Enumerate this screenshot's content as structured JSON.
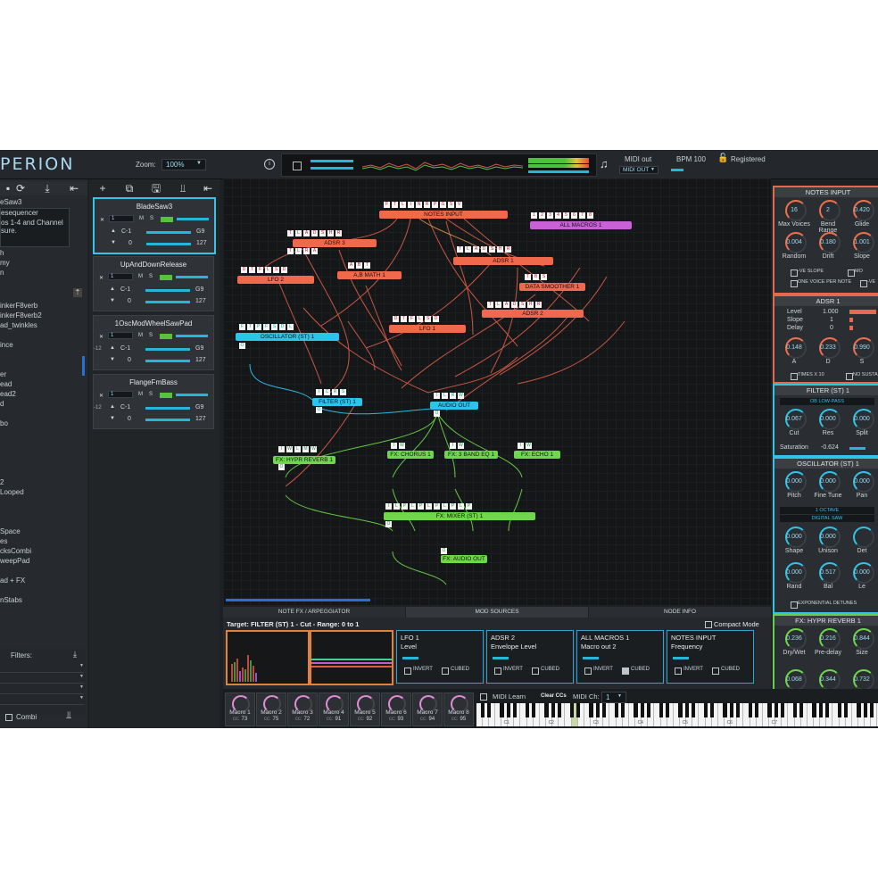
{
  "app": {
    "logo": "PERION"
  },
  "topbar": {
    "zoom_label": "Zoom:",
    "zoom_value": "100%",
    "midi_out_label": "MIDI out",
    "midi_out_value": "MIDI OUT",
    "bpm": "BPM 100",
    "registered": "Registered"
  },
  "left": {
    "preset_name": "eSaw3",
    "info_line1": "esequencer",
    "info_line2": "os 1-4 and Channel",
    "info_line3": "sure.",
    "info_line4": "h",
    "info_line5": "my",
    "info_line6": "n",
    "list": [
      "inkerF8verb",
      "inkerF8verb2",
      "ad_twinkles",
      "",
      "ince",
      "",
      "",
      "er",
      "ead",
      "ead2",
      "d",
      "",
      "bo",
      "",
      "",
      "",
      "",
      "",
      "2",
      "Looped",
      "",
      "",
      "",
      "Space",
      "es",
      "cksCombi",
      "weepPad",
      "",
      "ad + FX",
      "",
      "nStabs"
    ],
    "filters_label": "Filters:",
    "combi_label": "Combi"
  },
  "presets": [
    {
      "title": "BladeSaw3",
      "note_lo": "C-1",
      "note_hi": "G9",
      "vel_lo": "0",
      "vel_hi": "127",
      "transpose": "",
      "channel": "1"
    },
    {
      "title": "UpAndDownRelease",
      "note_lo": "C-1",
      "note_hi": "G9",
      "vel_lo": "0",
      "vel_hi": "127",
      "transpose": "",
      "channel": "1"
    },
    {
      "title": "1OscModWheelSawPad",
      "note_lo": "C-1",
      "note_hi": "G9",
      "vel_lo": "0",
      "vel_hi": "127",
      "transpose": "-12",
      "channel": "1"
    },
    {
      "title": "FlangeFmBass",
      "note_lo": "C-1",
      "note_hi": "G9",
      "vel_lo": "0",
      "vel_hi": "127",
      "transpose": "-12",
      "channel": "1"
    }
  ],
  "preset_row_labels": {
    "x": "X",
    "m": "M",
    "s": "S"
  },
  "nodes": {
    "notes_input": "NOTES INPUT",
    "all_macros": "ALL MACROS 1",
    "adsr3": "ADSR 3",
    "adsr1": "ADSR 1",
    "lfo2": "LFO 2",
    "ab_math": "A,B MATH 1",
    "data_smoother": "DATA SMOOTHER 1",
    "adsr2": "ADSR 2",
    "oscillator": "OSCILLATOR (ST) 1",
    "lfo1": "LFO 1",
    "filter": "FILTER (ST) 1",
    "audio_out": "AUDIO OUT",
    "hypr_reverb": "FX: HYPR REVERB 1",
    "chorus": "FX: CHORUS 1",
    "eq": "FX: 3 BAND EQ 1",
    "echo": "FX: ECHO 1",
    "mixer": "FX: MIXER (ST) 1",
    "fx_audio_out": "FX: AUDIO OUT"
  },
  "right": {
    "notes_input": {
      "title": "NOTES INPUT",
      "knobs": [
        {
          "label": "Max Voices",
          "value": "16"
        },
        {
          "label": "Bend Range",
          "value": "2"
        },
        {
          "label": "Glide",
          "value": "0.420"
        },
        {
          "label": "Random",
          "value": "0.004"
        },
        {
          "label": "Drift",
          "value": "0.180"
        },
        {
          "label": "Slope",
          "value": "1.001"
        }
      ],
      "opt1": "-VE SLOPE",
      "opt2": "MO",
      "opt3": "ONE VOICE PER NOTE",
      "opt4": "-VE"
    },
    "adsr": {
      "title": "ADSR 1",
      "level_label": "Level",
      "level_value": "1.000",
      "slope_label": "Slope",
      "slope_value": "1",
      "delay_label": "Delay",
      "delay_value": "0",
      "knobs": [
        {
          "label": "A",
          "value": "0.148"
        },
        {
          "label": "D",
          "value": "0.233"
        },
        {
          "label": "S",
          "value": "0.990"
        }
      ],
      "opt1": "TIMES X 10",
      "opt2": "NO SUSTA"
    },
    "filter": {
      "title": "FILTER (ST) 1",
      "mode": "OB LOW-PASS",
      "knobs": [
        {
          "label": "Cut",
          "value": "0.067"
        },
        {
          "label": "Res",
          "value": "0.000"
        },
        {
          "label": "Split",
          "value": "0.000"
        }
      ],
      "sat_label": "Saturation",
      "sat_value": "-0.624"
    },
    "oscillator": {
      "title": "OSCILLATOR (ST) 1",
      "knobs": [
        {
          "label": "Pitch",
          "value": "0.000"
        },
        {
          "label": "Fine Tune",
          "value": "0.000"
        },
        {
          "label": "Pan",
          "value": "0.000"
        }
      ],
      "octave": "1 OCTAVE",
      "wave": "DIGITAL SAW",
      "knobs2": [
        {
          "label": "Shape",
          "value": "0.000"
        },
        {
          "label": "Unison",
          "value": "0.000"
        },
        {
          "label": "Det",
          "value": ""
        }
      ],
      "knobs3": [
        {
          "label": "Rand",
          "value": "0.000"
        },
        {
          "label": "Bal",
          "value": "0.517"
        },
        {
          "label": "Le",
          "value": "0.000"
        }
      ],
      "opt": "EXPONENTIAL DETUNES"
    },
    "reverb": {
      "title": "FX: HYPR REVERB 1",
      "knobs": [
        {
          "label": "Dry/Wet",
          "value": "0.236"
        },
        {
          "label": "Pre-delay",
          "value": "0.216"
        },
        {
          "label": "Size",
          "value": "0.844"
        }
      ],
      "vals2": [
        "0.068",
        "0.344",
        "0.732"
      ]
    }
  },
  "bottom": {
    "tabs": [
      "NOTE FX / ARPEGGIATOR",
      "MOD SOURCES",
      "NODE INFO"
    ],
    "compact_mode": "Compact Mode",
    "target": "Target: FILTER (ST) 1 - Cut - Range: 0 to 1",
    "mods": [
      {
        "title": "LFO 1",
        "sub": "Level",
        "cubed_checked": false
      },
      {
        "title": "ADSR 2",
        "sub": "Envelope Level",
        "cubed_checked": false
      },
      {
        "title": "ALL MACROS 1",
        "sub": "Macro out 2",
        "cubed_checked": true
      },
      {
        "title": "NOTES INPUT",
        "sub": "Frequency",
        "cubed_checked": false
      }
    ],
    "invert_label": "INVERT",
    "cubed_label": "CUBED",
    "macros": [
      {
        "label": "Macro 1",
        "cc": "73"
      },
      {
        "label": "Macro 2",
        "cc": "75"
      },
      {
        "label": "Macro 3",
        "cc": "72"
      },
      {
        "label": "Macro 4",
        "cc": "91"
      },
      {
        "label": "Macro 5",
        "cc": "92"
      },
      {
        "label": "Macro 6",
        "cc": "93"
      },
      {
        "label": "Macro 7",
        "cc": "94"
      },
      {
        "label": "Macro 8",
        "cc": "95"
      }
    ],
    "cc_prefix": "cc:",
    "midi_learn": "MIDI Learn",
    "clear_ccs": "Clear CCs",
    "midi_ch_label": "MIDI Ch:",
    "midi_ch_value": "1",
    "octave_labels": [
      "C1",
      "C2",
      "C3",
      "C4",
      "C5",
      "C6",
      "C7"
    ]
  },
  "colors": {
    "accent_blue": "#2fc4e8",
    "accent_orange": "#f0694c",
    "accent_green": "#6ed84a",
    "accent_purple": "#c861d6"
  }
}
